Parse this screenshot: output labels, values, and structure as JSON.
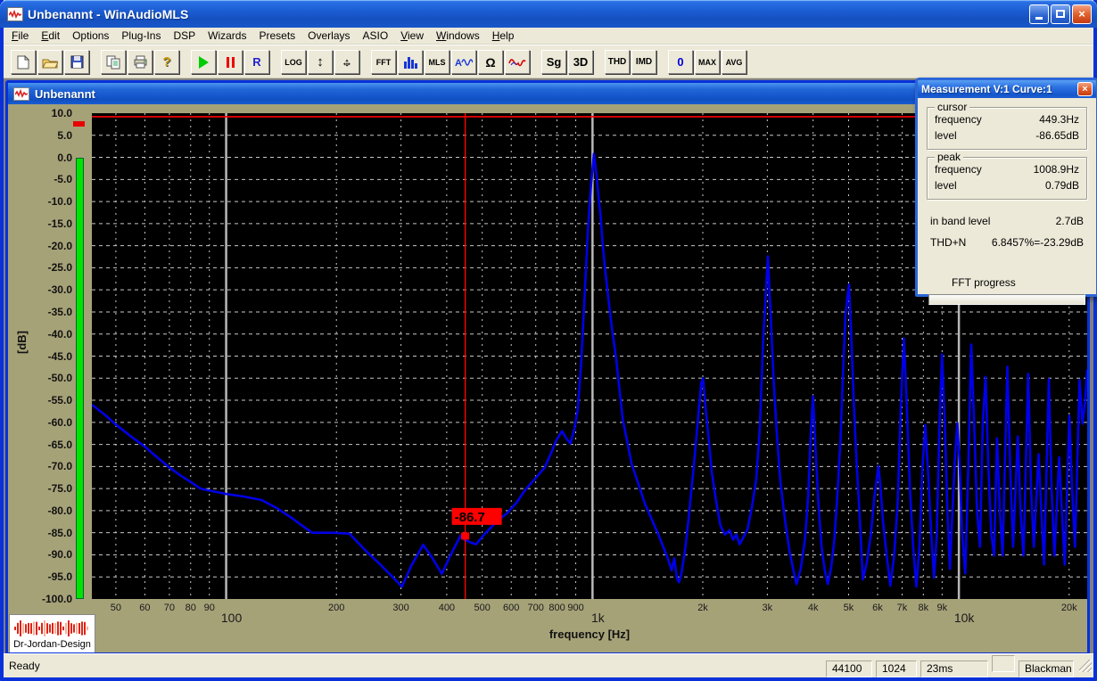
{
  "app": {
    "title": "Unbenannt - WinAudioMLS"
  },
  "window_controls": {
    "minimize": "minimize",
    "maximize": "maximize",
    "close": "close"
  },
  "menu": {
    "items": [
      {
        "label": "File",
        "u": 0
      },
      {
        "label": "Edit",
        "u": 0
      },
      {
        "label": "Options",
        "u": null
      },
      {
        "label": "Plug-Ins",
        "u": null
      },
      {
        "label": "DSP",
        "u": null
      },
      {
        "label": "Wizards",
        "u": null
      },
      {
        "label": "Presets",
        "u": null
      },
      {
        "label": "Overlays",
        "u": null
      },
      {
        "label": "ASIO",
        "u": null
      },
      {
        "label": "View",
        "u": 0
      },
      {
        "label": "Windows",
        "u": 0
      },
      {
        "label": "Help",
        "u": 0
      }
    ]
  },
  "toolbar": {
    "groups": [
      [
        {
          "name": "new-file",
          "icon": "new-document-icon"
        },
        {
          "name": "open-file",
          "icon": "open-folder-icon"
        },
        {
          "name": "save-file",
          "icon": "floppy-disk-icon"
        }
      ],
      [
        {
          "name": "copy",
          "icon": "copy-pages-icon"
        },
        {
          "name": "print",
          "icon": "printer-icon"
        },
        {
          "name": "help",
          "icon": "question-mark-icon"
        }
      ],
      [
        {
          "name": "play",
          "icon": "play-triangle-icon"
        },
        {
          "name": "pause",
          "icon": "pause-bars-icon"
        },
        {
          "name": "record",
          "label": "R",
          "color": "#2222cc",
          "size": 13
        }
      ],
      [
        {
          "name": "log-scale",
          "label": "LOG",
          "size": 9
        },
        {
          "name": "zoom-vertical",
          "icon": "vertical-arrows-icon"
        },
        {
          "name": "pan",
          "icon": "move-arrows-icon"
        }
      ],
      [
        {
          "name": "fft-mode",
          "label": "FFT",
          "size": 9
        },
        {
          "name": "spectrum-view",
          "icon": "bar-spectrum-icon"
        },
        {
          "name": "mls-mode",
          "label": "MLS",
          "size": 9
        },
        {
          "name": "signal-trace",
          "icon": "sine-a-icon"
        },
        {
          "name": "impedance",
          "label": "Ω",
          "size": 14
        },
        {
          "name": "sweep",
          "icon": "red-wave-icon"
        }
      ],
      [
        {
          "name": "signal-generator",
          "label": "Sg",
          "size": 13
        },
        {
          "name": "three-d-view",
          "label": "3D",
          "size": 13
        }
      ],
      [
        {
          "name": "thd",
          "label": "THD",
          "size": 10
        },
        {
          "name": "imd",
          "label": "IMD",
          "size": 10
        }
      ],
      [
        {
          "name": "reset-zero",
          "label": "0",
          "color": "#0000dd",
          "size": 13
        },
        {
          "name": "max-hold",
          "label": "MAX",
          "size": 9
        },
        {
          "name": "average",
          "label": "AVG",
          "size": 9
        }
      ]
    ]
  },
  "document_window": {
    "title": "Unbenannt"
  },
  "axis": {
    "y_unit": "[dB]",
    "x_label": "frequency [Hz]"
  },
  "logo": {
    "text": "Dr-Jordan-Design"
  },
  "measurement": {
    "title": "Measurement V:1 Curve:1",
    "groups": [
      {
        "legend": "cursor",
        "rows": [
          [
            "frequency",
            "449.3Hz"
          ],
          [
            "level",
            "-86.65dB"
          ]
        ]
      },
      {
        "legend": "peak",
        "rows": [
          [
            "frequency",
            "1008.9Hz"
          ],
          [
            "level",
            "0.79dB"
          ]
        ]
      }
    ],
    "rows": [
      [
        "in band level",
        "2.7dB"
      ],
      [
        "THD+N",
        "6.8457%=-23.29dB"
      ]
    ],
    "progress_label": "FFT progress"
  },
  "status": {
    "ready": "Ready",
    "panels": [
      "44100",
      "1024",
      "23ms",
      "",
      "Blackman"
    ]
  },
  "colors": {
    "curve": "#0000e8",
    "grid": "#c8c8c8",
    "decade_line": "#b8b8b8",
    "plot_bg": "#000000",
    "client_bg": "#a6a278",
    "cursor": "#ff0000",
    "limit_line": "#ff0000",
    "meter": "#00e400",
    "chrome": "#ece9d8",
    "titlebar": "#1b5cd3"
  },
  "chart_data": {
    "type": "line",
    "title": "FFT spectrum",
    "xlabel": "frequency [Hz]",
    "ylabel": "[dB]",
    "x_scale": "log",
    "xlim": [
      43,
      22400
    ],
    "ylim": [
      -100,
      10
    ],
    "y_tick_step": 5,
    "grid": true,
    "x_ticks_minor": [
      50,
      60,
      70,
      80,
      90,
      200,
      300,
      400,
      500,
      600,
      700,
      800,
      900,
      2000,
      3000,
      4000,
      5000,
      6000,
      7000,
      8000,
      9000,
      20000
    ],
    "x_ticks_minor_labels": [
      "50",
      "60",
      "70",
      "80",
      "90",
      "200",
      "300",
      "400",
      "500",
      "600",
      "700",
      "800",
      "900",
      "2k",
      "3k",
      "4k",
      "5k",
      "6k",
      "7k",
      "8k",
      "9k",
      "20k"
    ],
    "x_ticks_major": [
      100,
      1000,
      10000
    ],
    "x_ticks_major_labels": [
      "100",
      "1k",
      "10k"
    ],
    "limit_line_db": 9.2,
    "cursor": {
      "frequency_hz": 449.3,
      "level_db": -86.65,
      "label": "-86.7"
    },
    "level_meter": {
      "value_db": 0,
      "peak_db": 7.5
    },
    "series": [
      {
        "name": "Curve 1",
        "color": "#0000e8",
        "points": [
          [
            43,
            -56
          ],
          [
            47,
            -58.5
          ],
          [
            50,
            -60.5
          ],
          [
            55,
            -63.2
          ],
          [
            60,
            -65.5
          ],
          [
            65,
            -68
          ],
          [
            70,
            -70.2
          ],
          [
            75,
            -72
          ],
          [
            80,
            -73.5
          ],
          [
            85,
            -75
          ],
          [
            92,
            -75.6
          ],
          [
            100,
            -76.2
          ],
          [
            112,
            -76.8
          ],
          [
            125,
            -77.6
          ],
          [
            138,
            -79.5
          ],
          [
            150,
            -81.5
          ],
          [
            162,
            -83.5
          ],
          [
            172,
            -85
          ],
          [
            195,
            -85
          ],
          [
            217,
            -85.2
          ],
          [
            240,
            -89
          ],
          [
            262,
            -92
          ],
          [
            283,
            -94.8
          ],
          [
            302,
            -97.2
          ],
          [
            320,
            -92.5
          ],
          [
            345,
            -87.7
          ],
          [
            366,
            -90.8
          ],
          [
            388,
            -94.3
          ],
          [
            410,
            -90
          ],
          [
            436,
            -85.7
          ],
          [
            449.3,
            -86.65
          ],
          [
            465,
            -87.2
          ],
          [
            481,
            -87.6
          ],
          [
            505,
            -85.5
          ],
          [
            532,
            -83.5
          ],
          [
            560,
            -81.8
          ],
          [
            584,
            -80.6
          ],
          [
            620,
            -78.2
          ],
          [
            655,
            -75.3
          ],
          [
            700,
            -72.6
          ],
          [
            740,
            -70.3
          ],
          [
            775,
            -66.5
          ],
          [
            795,
            -64.2
          ],
          [
            826,
            -62
          ],
          [
            848,
            -63.6
          ],
          [
            870,
            -64.8
          ],
          [
            892,
            -61.5
          ],
          [
            912,
            -57
          ],
          [
            932,
            -46
          ],
          [
            952,
            -31
          ],
          [
            972,
            -16
          ],
          [
            990,
            -6.5
          ],
          [
            1008.9,
            0.79
          ],
          [
            1026,
            -4
          ],
          [
            1040,
            -9.5
          ],
          [
            1052,
            -13.2
          ],
          [
            1066,
            -19.5
          ],
          [
            1081,
            -24.8
          ],
          [
            1100,
            -30.5
          ],
          [
            1125,
            -37.5
          ],
          [
            1160,
            -45.5
          ],
          [
            1209,
            -59.2
          ],
          [
            1278,
            -69.3
          ],
          [
            1390,
            -78.4
          ],
          [
            1513,
            -85.4
          ],
          [
            1600,
            -90.5
          ],
          [
            1645,
            -93.5
          ],
          [
            1672,
            -90.8
          ],
          [
            1700,
            -95.3
          ],
          [
            1721,
            -96.2
          ],
          [
            1745,
            -94.6
          ],
          [
            1786,
            -89.5
          ],
          [
            1831,
            -81.4
          ],
          [
            1893,
            -69.3
          ],
          [
            1950,
            -57.2
          ],
          [
            1981,
            -51.1
          ],
          [
            2003,
            -50
          ],
          [
            2040,
            -57.5
          ],
          [
            2080,
            -64.5
          ],
          [
            2117,
            -71.3
          ],
          [
            2180,
            -78.4
          ],
          [
            2235,
            -83.4
          ],
          [
            2300,
            -85.4
          ],
          [
            2368,
            -84.4
          ],
          [
            2420,
            -86.6
          ],
          [
            2470,
            -85.4
          ],
          [
            2520,
            -87.6
          ],
          [
            2573,
            -86.3
          ],
          [
            2650,
            -84.2
          ],
          [
            2720,
            -79.4
          ],
          [
            2800,
            -72.8
          ],
          [
            2862,
            -61.5
          ],
          [
            2925,
            -41
          ],
          [
            3011,
            -22.4
          ],
          [
            3065,
            -36
          ],
          [
            3125,
            -51
          ],
          [
            3185,
            -62.5
          ],
          [
            3255,
            -73.3
          ],
          [
            3355,
            -82.3
          ],
          [
            3455,
            -89.5
          ],
          [
            3550,
            -94.2
          ],
          [
            3605,
            -96.6
          ],
          [
            3700,
            -93.2
          ],
          [
            3805,
            -86.3
          ],
          [
            3880,
            -76.5
          ],
          [
            3940,
            -63
          ],
          [
            3998,
            -54.1
          ],
          [
            4060,
            -65.5
          ],
          [
            4135,
            -78.3
          ],
          [
            4220,
            -88.2
          ],
          [
            4300,
            -93.3
          ],
          [
            4385,
            -96.6
          ],
          [
            4480,
            -93
          ],
          [
            4570,
            -86.8
          ],
          [
            4660,
            -76.5
          ],
          [
            4755,
            -63.5
          ],
          [
            4835,
            -47.5
          ],
          [
            4905,
            -35.5
          ],
          [
            5011,
            -28.8
          ],
          [
            5085,
            -40.5
          ],
          [
            5165,
            -55.5
          ],
          [
            5255,
            -68.5
          ],
          [
            5355,
            -80.5
          ],
          [
            5470,
            -95.6
          ],
          [
            5600,
            -92
          ],
          [
            5755,
            -85.2
          ],
          [
            5875,
            -77.3
          ],
          [
            5960,
            -73.2
          ],
          [
            6030,
            -69.9
          ],
          [
            6105,
            -74.3
          ],
          [
            6205,
            -82.3
          ],
          [
            6355,
            -90.2
          ],
          [
            6500,
            -97
          ],
          [
            6655,
            -90.3
          ],
          [
            6805,
            -78.2
          ],
          [
            6955,
            -55.3
          ],
          [
            7080,
            -41
          ],
          [
            7205,
            -55.5
          ],
          [
            7355,
            -75.3
          ],
          [
            7505,
            -88.2
          ],
          [
            7655,
            -97.2
          ],
          [
            7805,
            -88.3
          ],
          [
            7955,
            -70.3
          ],
          [
            8100,
            -60.6
          ],
          [
            8255,
            -72.3
          ],
          [
            8405,
            -85.2
          ],
          [
            8555,
            -95.2
          ],
          [
            8705,
            -85.3
          ],
          [
            8855,
            -60.3
          ],
          [
            9000,
            -44.6
          ],
          [
            9155,
            -60.3
          ],
          [
            9305,
            -80.2
          ],
          [
            9455,
            -93.2
          ],
          [
            9605,
            -80.3
          ],
          [
            9755,
            -68.3
          ],
          [
            9905,
            -60.2
          ],
          [
            10060,
            -70.3
          ],
          [
            10210,
            -85.2
          ],
          [
            10410,
            -94.2
          ],
          [
            10610,
            -70.3
          ],
          [
            10810,
            -42.4
          ],
          [
            11010,
            -60.3
          ],
          [
            11210,
            -80.2
          ],
          [
            11420,
            -88.2
          ],
          [
            11620,
            -60.3
          ],
          [
            11830,
            -49.7
          ],
          [
            12040,
            -70.3
          ],
          [
            12260,
            -85.2
          ],
          [
            12480,
            -90.2
          ],
          [
            12710,
            -63.6
          ],
          [
            12940,
            -80.2
          ],
          [
            13170,
            -90.2
          ],
          [
            13560,
            -47.4
          ],
          [
            13810,
            -70.3
          ],
          [
            14060,
            -88.2
          ],
          [
            14480,
            -63.2
          ],
          [
            14740,
            -80.2
          ],
          [
            15010,
            -90.2
          ],
          [
            15460,
            -49
          ],
          [
            15740,
            -75.2
          ],
          [
            16020,
            -88.2
          ],
          [
            16500,
            -67.2
          ],
          [
            16790,
            -80.2
          ],
          [
            17090,
            -92.2
          ],
          [
            17600,
            -50.2
          ],
          [
            17910,
            -75.2
          ],
          [
            18230,
            -90.2
          ],
          [
            18780,
            -67.9
          ],
          [
            19110,
            -80.2
          ],
          [
            19450,
            -92.2
          ],
          [
            20030,
            -58.5
          ],
          [
            20380,
            -75.2
          ],
          [
            20740,
            -88.2
          ],
          [
            21360,
            -50.4
          ],
          [
            21740,
            -60.3
          ],
          [
            22130,
            -55.2
          ],
          [
            22400,
            -48
          ]
        ]
      }
    ]
  }
}
